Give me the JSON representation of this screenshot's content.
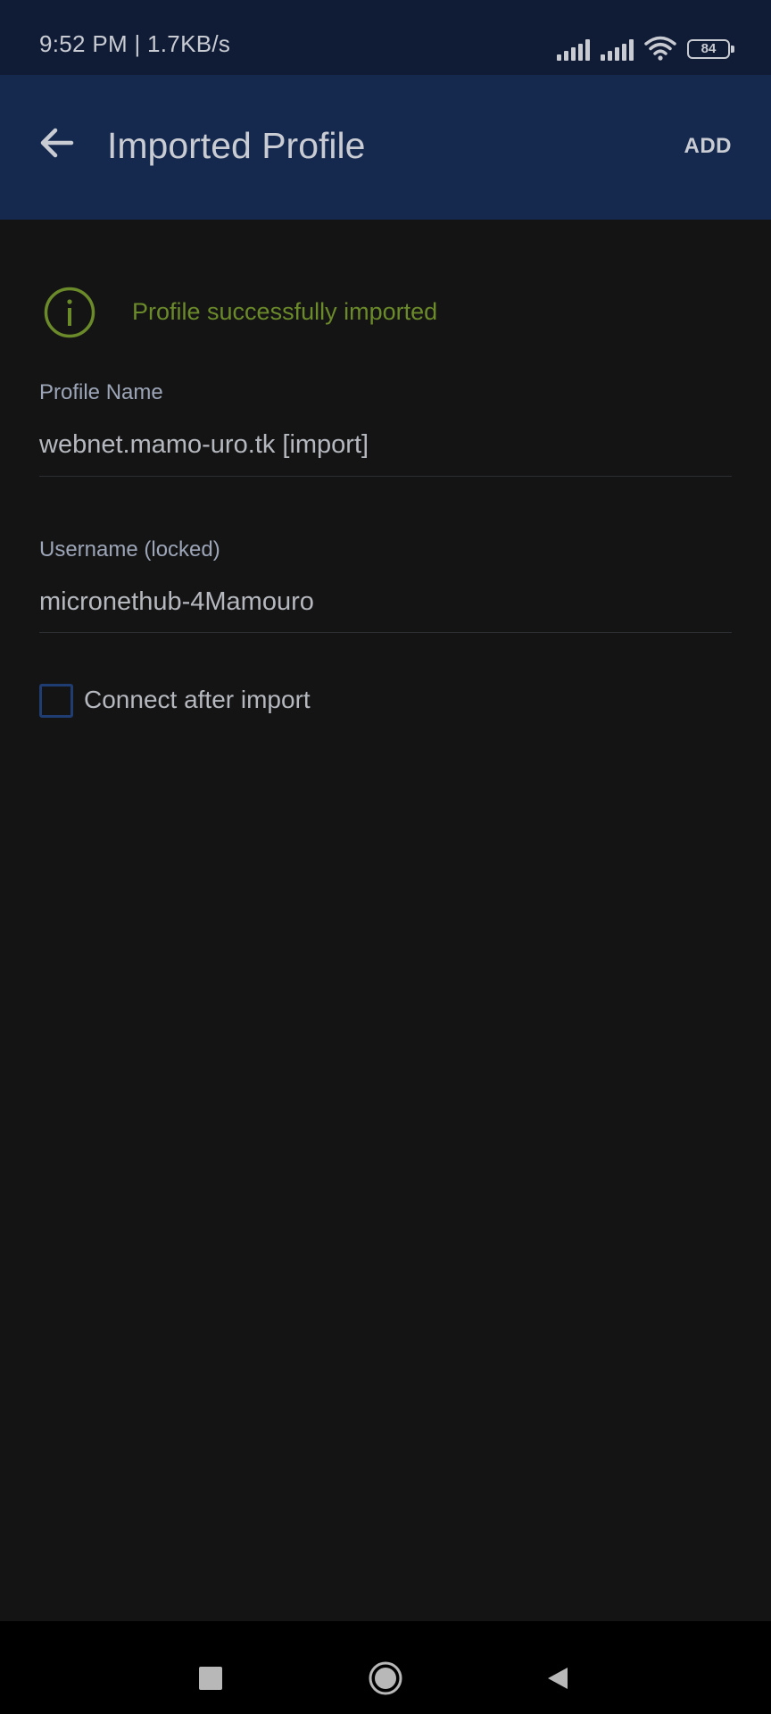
{
  "status_bar": {
    "time": "9:52 PM | 1.7KB/s",
    "battery_level": "84",
    "icons": [
      "signal-icon",
      "signal-icon",
      "wifi-icon",
      "battery-icon"
    ]
  },
  "app_bar": {
    "title": "Imported Profile",
    "add_label": "ADD",
    "back_icon": "arrow-left-icon"
  },
  "success": {
    "message": "Profile successfully imported",
    "icon": "info-circle-icon",
    "color": "#6b8a2a"
  },
  "profile_name": {
    "label": "Profile Name",
    "value": "webnet.mamo-uro.tk [import]"
  },
  "username": {
    "label": "Username (locked)",
    "value": "micronethub-4Mamouro"
  },
  "connect_after_import": {
    "label": "Connect after import",
    "checked": false
  },
  "nav_bar": {
    "icons": [
      "recents-square-icon",
      "home-circle-icon",
      "back-triangle-icon"
    ]
  },
  "colors": {
    "status_bar_bg": "#101c36",
    "app_bar_bg": "#15294f",
    "background": "#141414",
    "accent": "#1f3d72"
  }
}
